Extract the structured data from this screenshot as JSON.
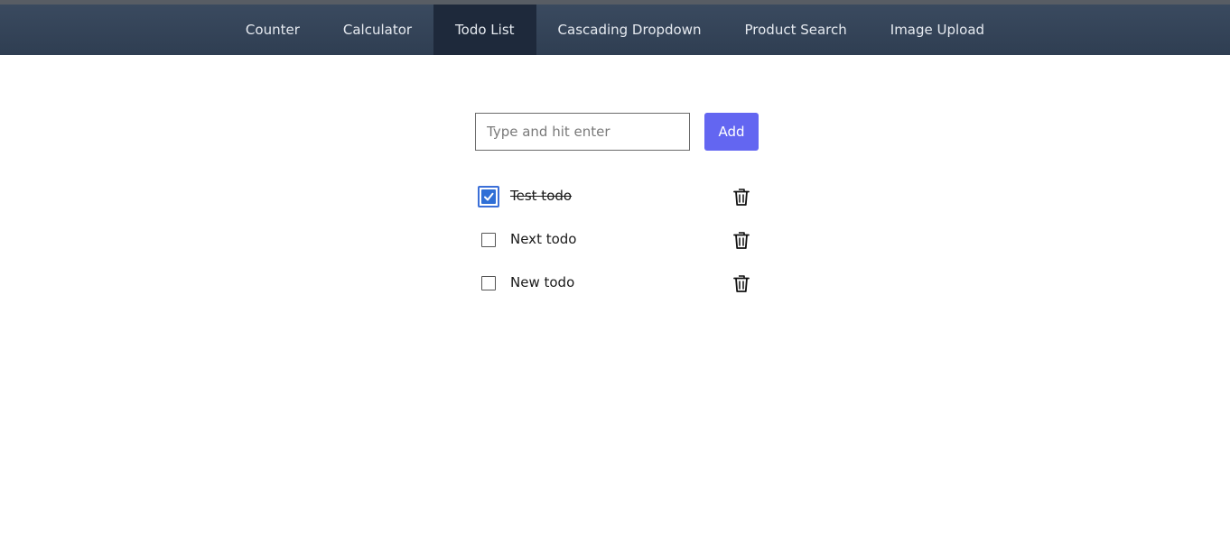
{
  "nav": {
    "tabs": [
      {
        "label": "Counter"
      },
      {
        "label": "Calculator"
      },
      {
        "label": "Todo List",
        "active": true
      },
      {
        "label": "Cascading Dropdown"
      },
      {
        "label": "Product Search"
      },
      {
        "label": "Image Upload"
      }
    ]
  },
  "todo": {
    "input": {
      "value": "",
      "placeholder": "Type and hit enter"
    },
    "add_label": "Add",
    "items": [
      {
        "text": "Test todo",
        "done": true
      },
      {
        "text": "Next todo",
        "done": false
      },
      {
        "text": "New todo",
        "done": false
      }
    ]
  },
  "colors": {
    "nav_bg": "#334155",
    "nav_active": "#1e293b",
    "accent": "#6366f1",
    "checkbox": "#2f6fd6"
  },
  "icons": {
    "delete": "trash-icon",
    "check": "checkmark-icon"
  }
}
